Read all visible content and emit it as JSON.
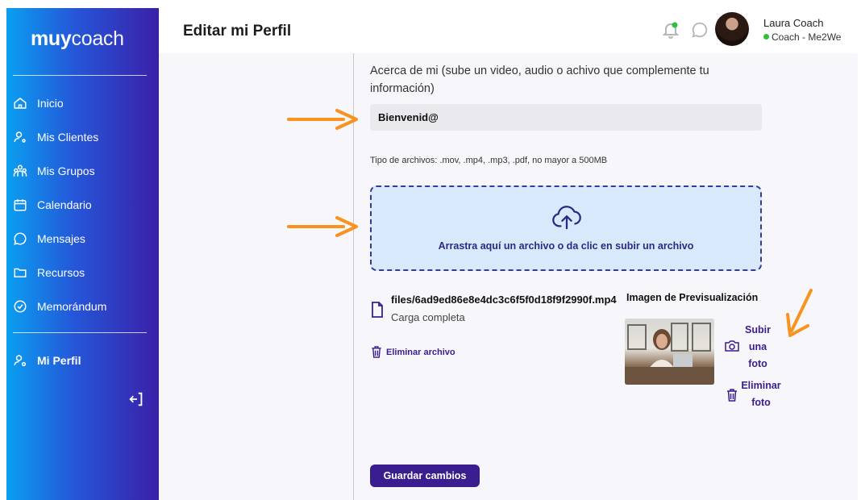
{
  "sidebar": {
    "logo_bold": "muy",
    "logo_light": "coach",
    "items": [
      {
        "label": "Inicio",
        "icon": "home-icon"
      },
      {
        "label": "Mis Clientes",
        "icon": "user-icon"
      },
      {
        "label": "Mis Grupos",
        "icon": "group-icon"
      },
      {
        "label": "Calendario",
        "icon": "calendar-icon"
      },
      {
        "label": "Mensajes",
        "icon": "chat-icon"
      },
      {
        "label": "Recursos",
        "icon": "folder-icon"
      },
      {
        "label": "Memorándum",
        "icon": "check-circle-icon"
      }
    ],
    "profile": {
      "label": "Mi Perfil",
      "icon": "user-settings-icon"
    },
    "logout_icon": "logout-icon"
  },
  "header": {
    "title": "Editar mi Perfil",
    "user_name": "Laura Coach",
    "user_role": "Coach - Me2We",
    "status_color": "#2ec23c"
  },
  "form": {
    "about_label": "Acerca de mi (sube un video, audio o achivo que complemente tu información)",
    "about_value": "Bienvenid@",
    "file_types": "Tipo de archivos: .mov, .mp4, .mp3, .pdf, no mayor a 500MB",
    "dropzone_text": "Arrastra aquí un archivo o da clic en subir un archivo",
    "file_name": "files/6ad9ed86e8e4dc3c6f5f0d18f9f2990f.mp4",
    "file_status": "Carga completa",
    "delete_file": "Eliminar archivo",
    "preview_title": "Imagen de Previsualización",
    "upload_photo": [
      "Subir",
      "una",
      "foto"
    ],
    "delete_photo": [
      "Eliminar",
      "foto"
    ],
    "save": "Guardar cambios"
  },
  "colors": {
    "accent": "#3a1d8f",
    "annotation_arrow": "#f7931e",
    "dropzone_bg": "#d8e9fb"
  }
}
